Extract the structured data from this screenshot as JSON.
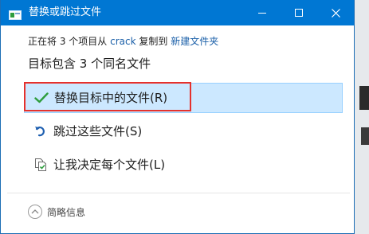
{
  "window": {
    "title": "替换或跳过文件",
    "minimize_glyph": "—",
    "maximize_glyph": "☐",
    "close_glyph": "✕"
  },
  "info": {
    "prefix": "正在将 3 个项目从",
    "source": "crack",
    "middle": "复制到",
    "destination": "新建文件夹"
  },
  "heading": "目标包含 3 个同名文件",
  "options": {
    "replace": {
      "label": "替换目标中的文件(R)",
      "icon": "checkmark-icon",
      "color": "#2e9d3d"
    },
    "skip": {
      "label": "跳过这些文件(S)",
      "icon": "skip-arrow-icon",
      "color": "#1e5fb0"
    },
    "decide": {
      "label": "让我决定每个文件(L)",
      "icon": "compare-files-icon"
    }
  },
  "footer": {
    "details_label": "简略信息",
    "details_icon": "chevron-up-icon"
  },
  "colors": {
    "titlebar": "#0077d3",
    "selected_bg": "#cce8ff",
    "link": "#1a5fa8",
    "highlight_frame": "#e5312d"
  }
}
